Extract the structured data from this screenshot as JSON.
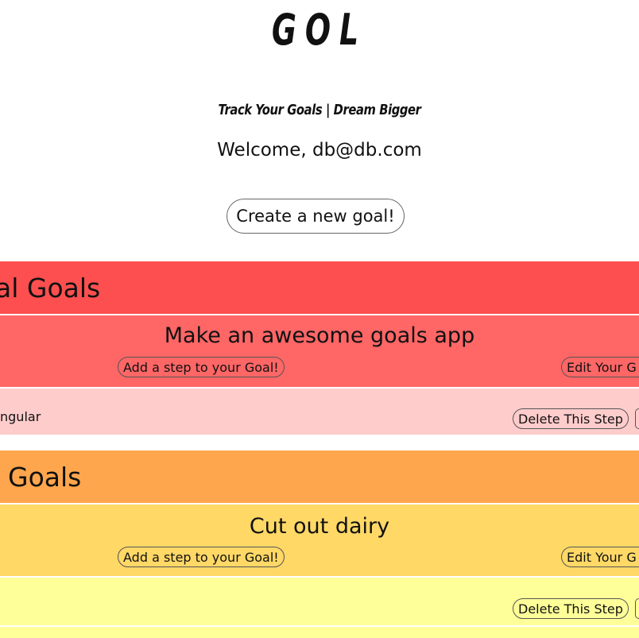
{
  "app": {
    "logo": "GOL",
    "tagline": "Track Your Goals | Dream Bigger",
    "welcome": "Welcome, db@db.com",
    "create_button": "Create a new goal!"
  },
  "categories": [
    {
      "header": "al Goals",
      "color": "#fd4f4f",
      "goal": {
        "title": "Make an awesome goals app",
        "color": "#ff6666",
        "add_step": "Add a step to your Goal!",
        "edit": "Edit Your G"
      },
      "step": {
        "text": "ngular",
        "color": "#ffcccc",
        "delete": "Delete This Step"
      }
    },
    {
      "header": "Goals",
      "color": "#fea64d",
      "goal": {
        "title": "Cut out dairy",
        "color": "#ffd866",
        "add_step": "Add a step to your Goal!",
        "edit": "Edit Your G"
      },
      "step": {
        "text": "",
        "color": "#ffff99",
        "delete": "Delete This Step"
      }
    }
  ]
}
